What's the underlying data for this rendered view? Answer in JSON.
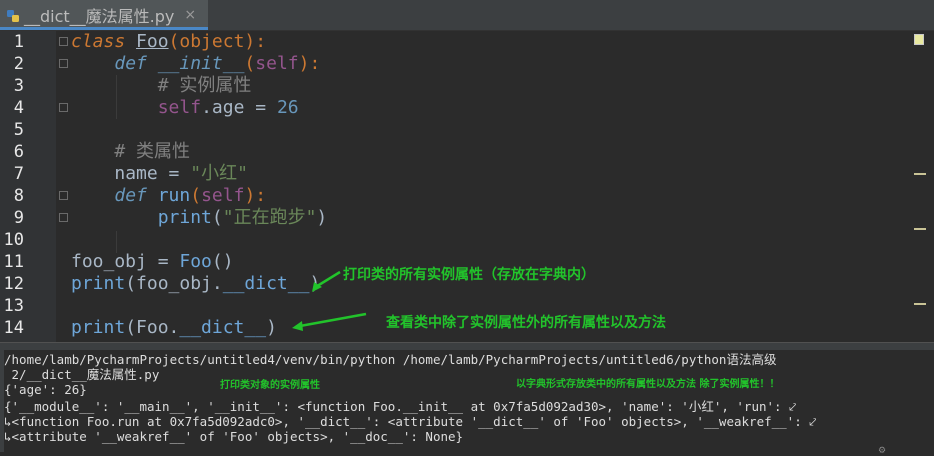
{
  "tab": {
    "filename": "__dict__魔法属性.py",
    "close_glyph": "×"
  },
  "editor": {
    "line_numbers": [
      "1",
      "2",
      "3",
      "4",
      "5",
      "6",
      "7",
      "8",
      "9",
      "10",
      "11",
      "12",
      "13",
      "14"
    ],
    "lines": {
      "l1": {
        "kw": "class",
        "name": "Foo",
        "rest": "(object):"
      },
      "l2": {
        "kw": "def",
        "name": "__init__",
        "self": "self",
        "rest": "):"
      },
      "l3": {
        "comment": "# 实例属性"
      },
      "l4": {
        "self": "self",
        "attr": ".age",
        "eq": " = ",
        "num": "26"
      },
      "l6": {
        "comment": "# 类属性"
      },
      "l7": {
        "var": "name",
        "eq": " = ",
        "str": "\"小红\""
      },
      "l8": {
        "kw": "def",
        "name": "run",
        "self": "self",
        "rest": "):"
      },
      "l9": {
        "fn": "print",
        "open": "(",
        "str": "\"正在跑步\"",
        "close": ")"
      },
      "l11": {
        "var": "foo_obj",
        "eq": " = ",
        "cls": "Foo",
        "call": "()"
      },
      "l12": {
        "fn": "print",
        "pre": "(foo_obj.",
        "dunder": "__dict__",
        "post": ")"
      },
      "l14": {
        "fn": "print",
        "pre": "(Foo.",
        "dunder": "__dict__",
        "post": ")"
      }
    }
  },
  "annotations": {
    "a1": "打印类的所有实例属性（存放在字典内）",
    "a2": "查看类中除了实例属性外的所有属性以及方法",
    "a3": "打印类对象的实例属性",
    "a4": "以字典形式存放类中的所有属性以及方法  除了实例属性！！"
  },
  "console": {
    "l1": "/home/lamb/PycharmProjects/untitled4/venv/bin/python /home/lamb/PycharmProjects/untitled6/python语法高级",
    "l2": " 2/__dict__魔法属性.py",
    "l3": "{'age': 26}",
    "l4": "{'__module__': '__main__', '__init__': <function Foo.__init__ at 0x7fa5d092ad30>, 'name': '小红', 'run': ⤦",
    "l5": "↳<function Foo.run at 0x7fa5d092adc0>, '__dict__': <attribute '__dict__' of 'Foo' objects>, '__weakref__': ⤦",
    "l6": "↳<attribute '__weakref__' of 'Foo' objects>, '__doc__': None}"
  },
  "colors": {
    "background": "#2b2b2b",
    "annotation_green": "#22c32b",
    "keyword": "#cc7832",
    "string": "#6a8759",
    "number": "#6897bb",
    "self": "#94558d",
    "dunder": "#b200b2"
  },
  "icons": [
    "python-file-icon",
    "close-icon",
    "arrow-icon"
  ]
}
